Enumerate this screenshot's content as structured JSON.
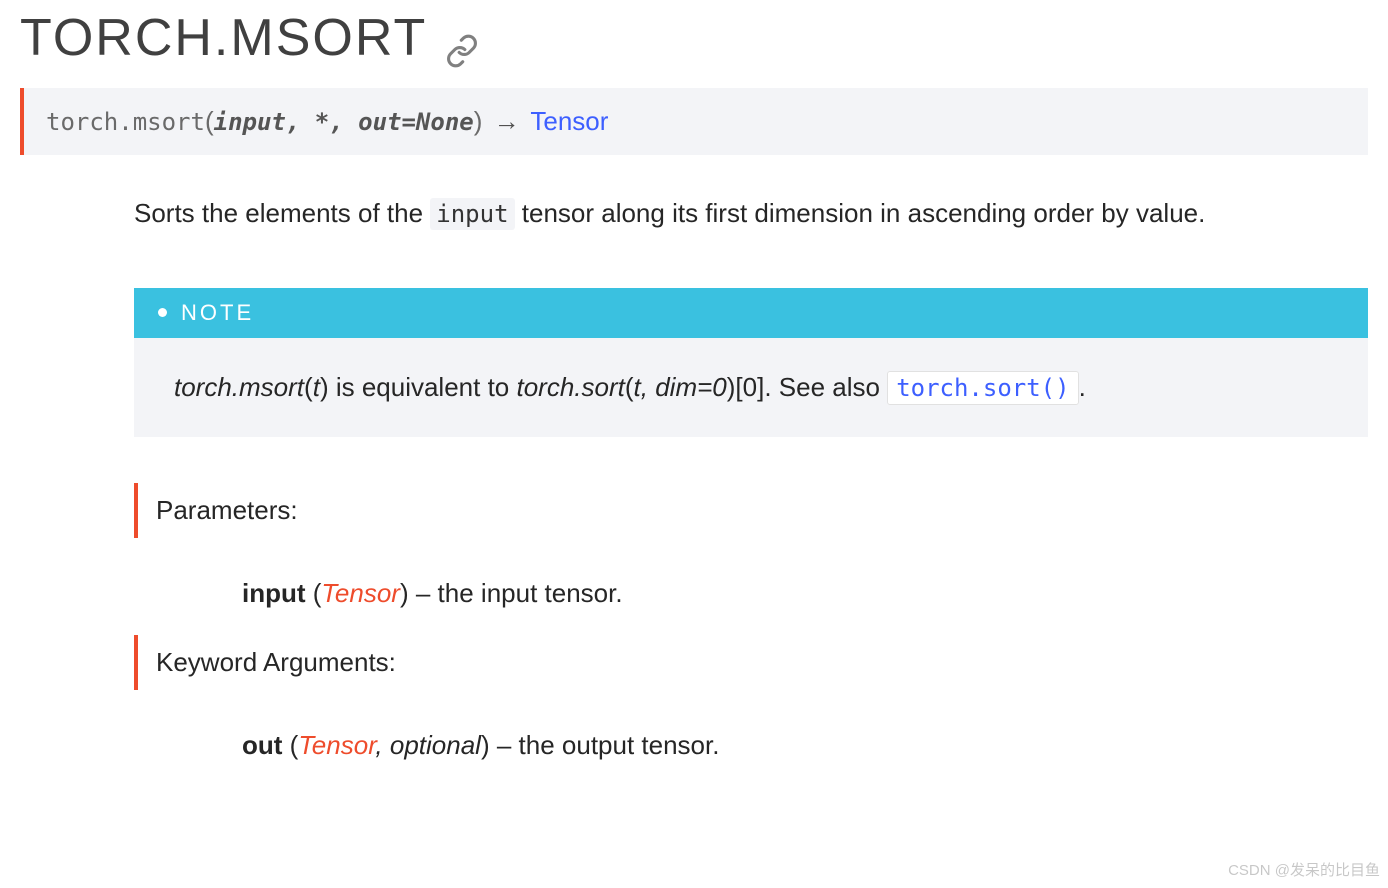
{
  "title": "TORCH.MSORT",
  "signature": {
    "fn": "torch.msort",
    "params": "input, *, out=None",
    "returns": "Tensor"
  },
  "description": {
    "before_code": "Sorts the elements of the ",
    "code": "input",
    "after_code": " tensor along its first dimension in ascending order by value."
  },
  "note": {
    "label": "NOTE",
    "text1_i": "torch.msort",
    "text1_after": "(",
    "text1_t": "t",
    "text1_close": ") is equivalent to ",
    "text2_i": "torch.sort",
    "text2_mid": "(",
    "text2_args": "t, dim=0",
    "text2_close": ")[0]. See also ",
    "code_link": "torch.sort()",
    "period": "."
  },
  "parameters": {
    "label": "Parameters:",
    "item": {
      "name": "input",
      "type": "Tensor",
      "desc": " – the input tensor."
    }
  },
  "kwargs": {
    "label": "Keyword Arguments:",
    "item": {
      "name": "out",
      "type": "Tensor",
      "optional": ", optional",
      "desc": " – the output tensor."
    }
  },
  "watermark": "CSDN @发呆的比目鱼"
}
